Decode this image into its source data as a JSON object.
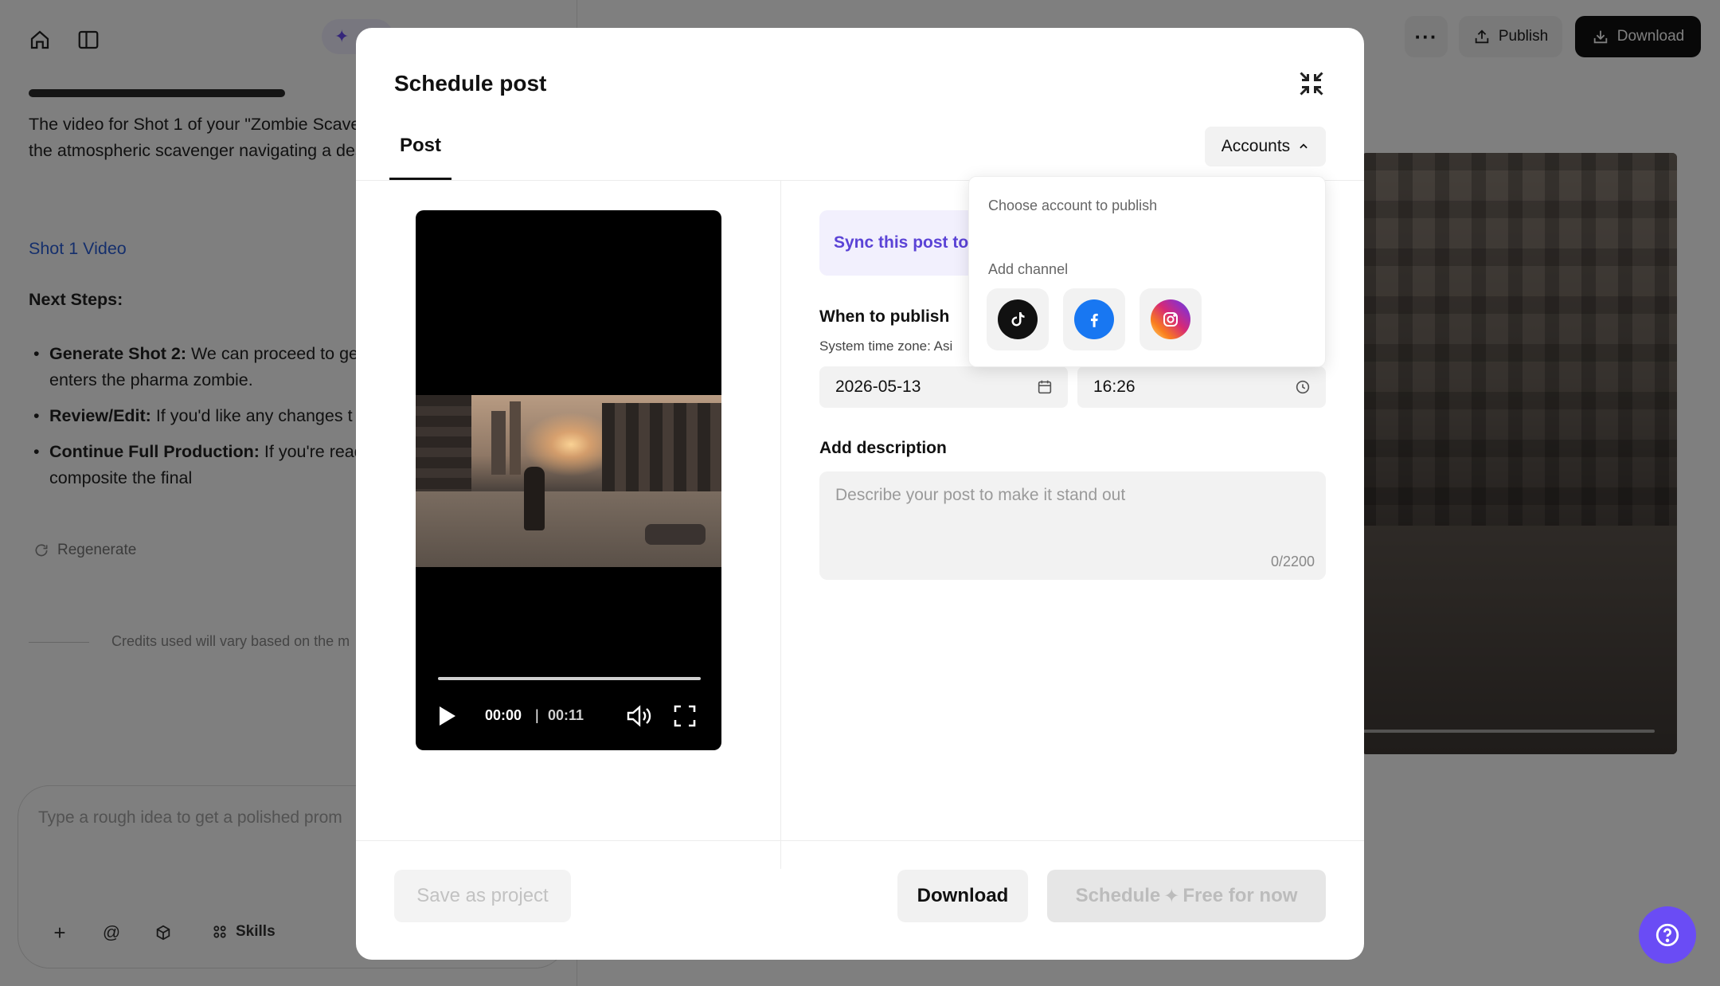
{
  "background": {
    "ai_pill_glyph": "✦",
    "chat_intro": "The video for Shot 1 of your \"Zombie Scave generated. This shot sets the atmospheric scavenger navigating a desolate city street his target.",
    "chat_link": "Shot 1 Video",
    "next_steps": "Next Steps:",
    "bullets": [
      {
        "title": "Generate Shot 2:",
        "text": " We can proceed to ge where the scavenger enters the pharma zombie."
      },
      {
        "title": "Review/Edit:",
        "text": " If you'd like any changes t"
      },
      {
        "title": "Continue Full Production:",
        "text": " If you're read remaining shots and composite the final"
      }
    ],
    "regenerate": "Regenerate",
    "credits": "Credits used will vary based on the m",
    "prompt_placeholder": "Type a rough idea to get a polished prom",
    "prompt_tools": {
      "plus": "+",
      "at": "@",
      "skills": "Skills"
    },
    "top_actions": {
      "more": "···",
      "publish": "Publish",
      "download": "Download"
    }
  },
  "modal": {
    "title": "Schedule post",
    "tab": "Post",
    "accounts_button": "Accounts",
    "video": {
      "current_time": "00:00",
      "separator": "|",
      "duration": "00:11"
    },
    "sync_text": "Sync this post to",
    "when_label": "When to publish",
    "timezone": "System time zone: Asi",
    "date": "2026-05-13",
    "time": "16:26",
    "description_label": "Add description",
    "description_placeholder": "Describe your post to make it stand out",
    "description_count": "0/2200",
    "footer": {
      "save_project": "Save as project",
      "download": "Download",
      "schedule": "Schedule",
      "schedule_icon": "✦",
      "schedule_suffix": "Free for now"
    }
  },
  "accounts_dropdown": {
    "choose": "Choose account to publish",
    "add_channel": "Add channel",
    "channels": [
      "tiktok-icon",
      "facebook-icon",
      "instagram-icon"
    ]
  },
  "colors": {
    "accent": "#6a4cf5",
    "sync_text": "#5b43d6",
    "facebook": "#1877f2"
  }
}
